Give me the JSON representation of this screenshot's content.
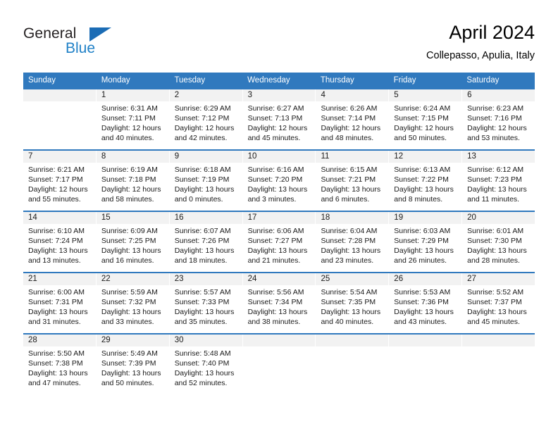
{
  "brand": {
    "name_part1": "General",
    "name_part2": "Blue",
    "color_dark": "#231f20",
    "color_blue": "#2081c7"
  },
  "header": {
    "title": "April 2024",
    "subtitle": "Collepasso, Apulia, Italy"
  },
  "theme": {
    "header_bg": "#3079be",
    "daynum_bg": "#f2f2f2",
    "cell_bg": "#ffffff",
    "text": "#1a1a1a"
  },
  "weekdays": [
    "Sunday",
    "Monday",
    "Tuesday",
    "Wednesday",
    "Thursday",
    "Friday",
    "Saturday"
  ],
  "weeks": [
    [
      {
        "day": "",
        "sunrise": "",
        "sunset": "",
        "daylight1": "",
        "daylight2": ""
      },
      {
        "day": "1",
        "sunrise": "Sunrise: 6:31 AM",
        "sunset": "Sunset: 7:11 PM",
        "daylight1": "Daylight: 12 hours",
        "daylight2": "and 40 minutes."
      },
      {
        "day": "2",
        "sunrise": "Sunrise: 6:29 AM",
        "sunset": "Sunset: 7:12 PM",
        "daylight1": "Daylight: 12 hours",
        "daylight2": "and 42 minutes."
      },
      {
        "day": "3",
        "sunrise": "Sunrise: 6:27 AM",
        "sunset": "Sunset: 7:13 PM",
        "daylight1": "Daylight: 12 hours",
        "daylight2": "and 45 minutes."
      },
      {
        "day": "4",
        "sunrise": "Sunrise: 6:26 AM",
        "sunset": "Sunset: 7:14 PM",
        "daylight1": "Daylight: 12 hours",
        "daylight2": "and 48 minutes."
      },
      {
        "day": "5",
        "sunrise": "Sunrise: 6:24 AM",
        "sunset": "Sunset: 7:15 PM",
        "daylight1": "Daylight: 12 hours",
        "daylight2": "and 50 minutes."
      },
      {
        "day": "6",
        "sunrise": "Sunrise: 6:23 AM",
        "sunset": "Sunset: 7:16 PM",
        "daylight1": "Daylight: 12 hours",
        "daylight2": "and 53 minutes."
      }
    ],
    [
      {
        "day": "7",
        "sunrise": "Sunrise: 6:21 AM",
        "sunset": "Sunset: 7:17 PM",
        "daylight1": "Daylight: 12 hours",
        "daylight2": "and 55 minutes."
      },
      {
        "day": "8",
        "sunrise": "Sunrise: 6:19 AM",
        "sunset": "Sunset: 7:18 PM",
        "daylight1": "Daylight: 12 hours",
        "daylight2": "and 58 minutes."
      },
      {
        "day": "9",
        "sunrise": "Sunrise: 6:18 AM",
        "sunset": "Sunset: 7:19 PM",
        "daylight1": "Daylight: 13 hours",
        "daylight2": "and 0 minutes."
      },
      {
        "day": "10",
        "sunrise": "Sunrise: 6:16 AM",
        "sunset": "Sunset: 7:20 PM",
        "daylight1": "Daylight: 13 hours",
        "daylight2": "and 3 minutes."
      },
      {
        "day": "11",
        "sunrise": "Sunrise: 6:15 AM",
        "sunset": "Sunset: 7:21 PM",
        "daylight1": "Daylight: 13 hours",
        "daylight2": "and 6 minutes."
      },
      {
        "day": "12",
        "sunrise": "Sunrise: 6:13 AM",
        "sunset": "Sunset: 7:22 PM",
        "daylight1": "Daylight: 13 hours",
        "daylight2": "and 8 minutes."
      },
      {
        "day": "13",
        "sunrise": "Sunrise: 6:12 AM",
        "sunset": "Sunset: 7:23 PM",
        "daylight1": "Daylight: 13 hours",
        "daylight2": "and 11 minutes."
      }
    ],
    [
      {
        "day": "14",
        "sunrise": "Sunrise: 6:10 AM",
        "sunset": "Sunset: 7:24 PM",
        "daylight1": "Daylight: 13 hours",
        "daylight2": "and 13 minutes."
      },
      {
        "day": "15",
        "sunrise": "Sunrise: 6:09 AM",
        "sunset": "Sunset: 7:25 PM",
        "daylight1": "Daylight: 13 hours",
        "daylight2": "and 16 minutes."
      },
      {
        "day": "16",
        "sunrise": "Sunrise: 6:07 AM",
        "sunset": "Sunset: 7:26 PM",
        "daylight1": "Daylight: 13 hours",
        "daylight2": "and 18 minutes."
      },
      {
        "day": "17",
        "sunrise": "Sunrise: 6:06 AM",
        "sunset": "Sunset: 7:27 PM",
        "daylight1": "Daylight: 13 hours",
        "daylight2": "and 21 minutes."
      },
      {
        "day": "18",
        "sunrise": "Sunrise: 6:04 AM",
        "sunset": "Sunset: 7:28 PM",
        "daylight1": "Daylight: 13 hours",
        "daylight2": "and 23 minutes."
      },
      {
        "day": "19",
        "sunrise": "Sunrise: 6:03 AM",
        "sunset": "Sunset: 7:29 PM",
        "daylight1": "Daylight: 13 hours",
        "daylight2": "and 26 minutes."
      },
      {
        "day": "20",
        "sunrise": "Sunrise: 6:01 AM",
        "sunset": "Sunset: 7:30 PM",
        "daylight1": "Daylight: 13 hours",
        "daylight2": "and 28 minutes."
      }
    ],
    [
      {
        "day": "21",
        "sunrise": "Sunrise: 6:00 AM",
        "sunset": "Sunset: 7:31 PM",
        "daylight1": "Daylight: 13 hours",
        "daylight2": "and 31 minutes."
      },
      {
        "day": "22",
        "sunrise": "Sunrise: 5:59 AM",
        "sunset": "Sunset: 7:32 PM",
        "daylight1": "Daylight: 13 hours",
        "daylight2": "and 33 minutes."
      },
      {
        "day": "23",
        "sunrise": "Sunrise: 5:57 AM",
        "sunset": "Sunset: 7:33 PM",
        "daylight1": "Daylight: 13 hours",
        "daylight2": "and 35 minutes."
      },
      {
        "day": "24",
        "sunrise": "Sunrise: 5:56 AM",
        "sunset": "Sunset: 7:34 PM",
        "daylight1": "Daylight: 13 hours",
        "daylight2": "and 38 minutes."
      },
      {
        "day": "25",
        "sunrise": "Sunrise: 5:54 AM",
        "sunset": "Sunset: 7:35 PM",
        "daylight1": "Daylight: 13 hours",
        "daylight2": "and 40 minutes."
      },
      {
        "day": "26",
        "sunrise": "Sunrise: 5:53 AM",
        "sunset": "Sunset: 7:36 PM",
        "daylight1": "Daylight: 13 hours",
        "daylight2": "and 43 minutes."
      },
      {
        "day": "27",
        "sunrise": "Sunrise: 5:52 AM",
        "sunset": "Sunset: 7:37 PM",
        "daylight1": "Daylight: 13 hours",
        "daylight2": "and 45 minutes."
      }
    ],
    [
      {
        "day": "28",
        "sunrise": "Sunrise: 5:50 AM",
        "sunset": "Sunset: 7:38 PM",
        "daylight1": "Daylight: 13 hours",
        "daylight2": "and 47 minutes."
      },
      {
        "day": "29",
        "sunrise": "Sunrise: 5:49 AM",
        "sunset": "Sunset: 7:39 PM",
        "daylight1": "Daylight: 13 hours",
        "daylight2": "and 50 minutes."
      },
      {
        "day": "30",
        "sunrise": "Sunrise: 5:48 AM",
        "sunset": "Sunset: 7:40 PM",
        "daylight1": "Daylight: 13 hours",
        "daylight2": "and 52 minutes."
      },
      {
        "day": "",
        "sunrise": "",
        "sunset": "",
        "daylight1": "",
        "daylight2": ""
      },
      {
        "day": "",
        "sunrise": "",
        "sunset": "",
        "daylight1": "",
        "daylight2": ""
      },
      {
        "day": "",
        "sunrise": "",
        "sunset": "",
        "daylight1": "",
        "daylight2": ""
      },
      {
        "day": "",
        "sunrise": "",
        "sunset": "",
        "daylight1": "",
        "daylight2": ""
      }
    ]
  ]
}
